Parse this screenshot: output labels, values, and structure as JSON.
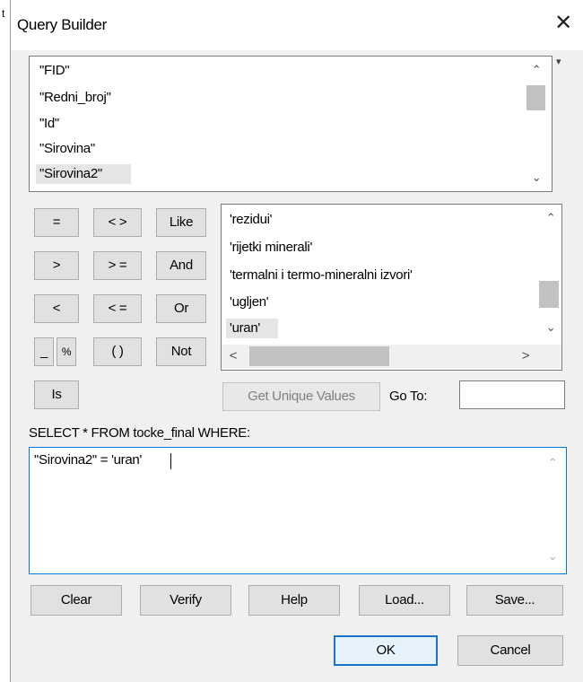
{
  "background": {
    "edge_char": "t"
  },
  "window": {
    "title": "Query Builder",
    "close_glyph": "✕"
  },
  "fields": {
    "items": [
      "\"FID\"",
      "\"Redni_broj\"",
      "\"Id\"",
      "\"Sirovina\"",
      "\"Sirovina2\""
    ],
    "selected": "\"Sirovina2\"",
    "corner_glyph": "▾"
  },
  "operators": {
    "eq": "=",
    "ne": "< >",
    "like": "Like",
    "gt": ">",
    "ge": "> =",
    "and": "And",
    "lt": "<",
    "le": "< =",
    "or": "Or",
    "underscore": "_",
    "percent": "%",
    "parens": "( )",
    "not": "Not",
    "is": "Is"
  },
  "values": {
    "items": [
      "'rezidui'",
      "'rijetki minerali'",
      "'termalni i termo-mineralni izvori'",
      "'ugljen'",
      "'uran'"
    ],
    "selected": "'uran'"
  },
  "scroll_glyphs": {
    "up": "⌃",
    "down": "⌄",
    "left": "<",
    "right": ">"
  },
  "get_unique_values": "Get Unique Values",
  "go_to": {
    "label": "Go To:",
    "value": ""
  },
  "sql_prefix": "SELECT * FROM tocke_final WHERE:",
  "expression": "\"Sirovina2\" = 'uran'",
  "buttons": {
    "clear": "Clear",
    "verify": "Verify",
    "help": "Help",
    "load": "Load...",
    "save": "Save..."
  },
  "dialog_buttons": {
    "ok": "OK",
    "cancel": "Cancel"
  },
  "colors": {
    "dialog_bg": "#f0f0f0",
    "accent": "#0078d7",
    "selection": "#e5e5e5"
  }
}
